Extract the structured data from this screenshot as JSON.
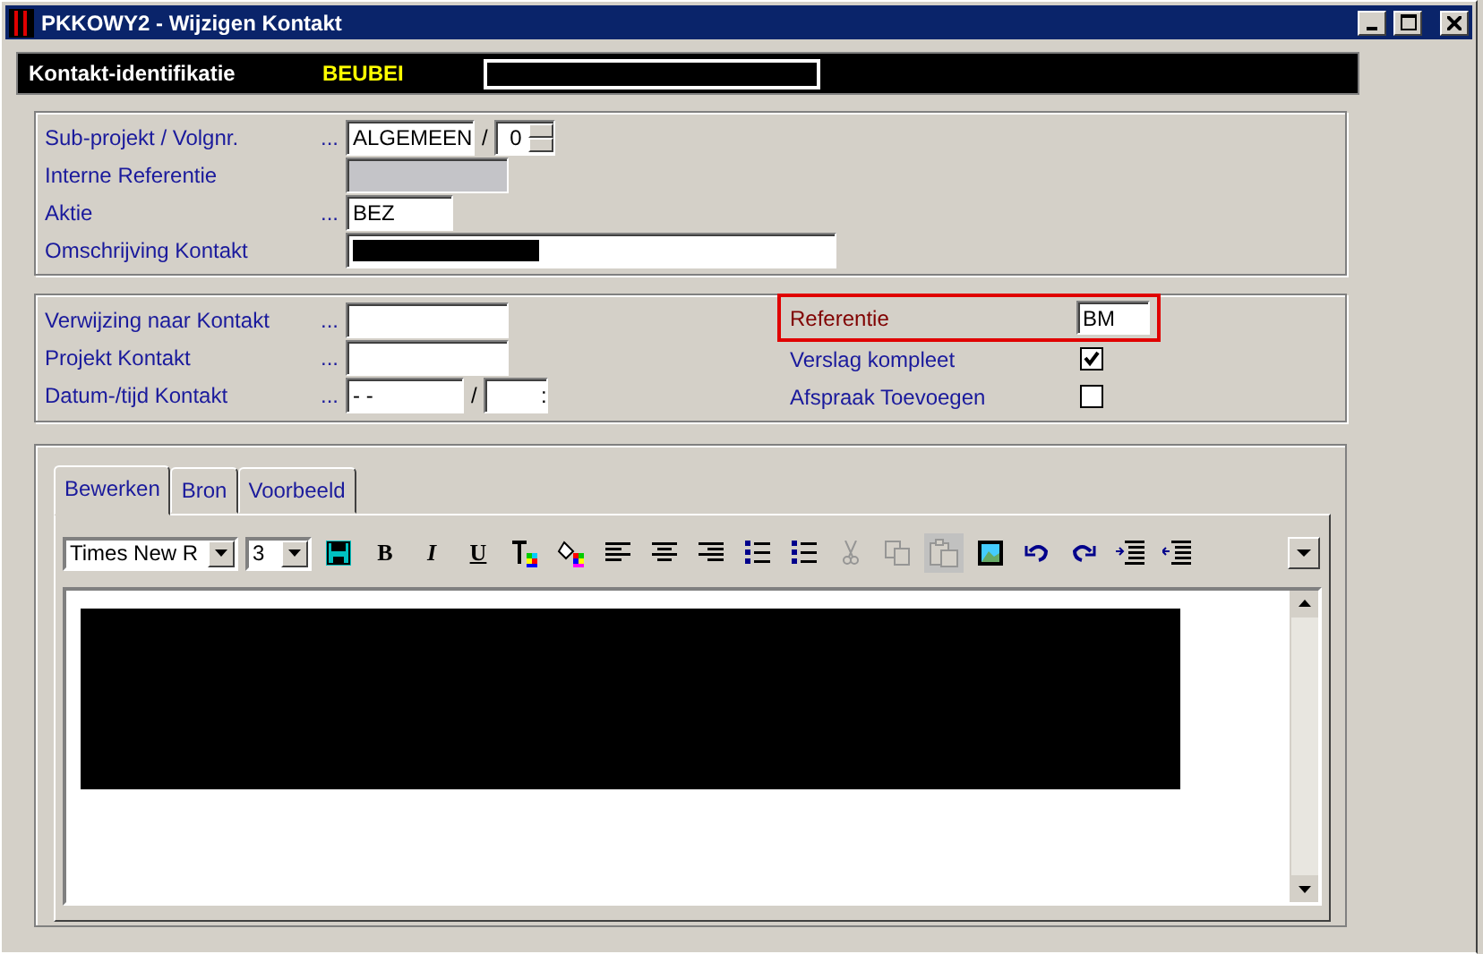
{
  "window": {
    "title": "PKKOWY2 - Wijzigen Kontakt"
  },
  "header": {
    "label": "Kontakt-identifikatie",
    "code": "BEUBEI"
  },
  "section1": [
    {
      "label": "Sub-projekt / Volgnr.",
      "dots": "...",
      "kind": "split",
      "value": "ALGEMEEN",
      "sep": "/",
      "value2": "0"
    },
    {
      "label": "Interne Referentie",
      "kind": "disabled"
    },
    {
      "label": "Aktie",
      "dots": "...",
      "kind": "text",
      "value": "BEZ"
    },
    {
      "label": "Omschrijving Kontakt",
      "kind": "redacted"
    }
  ],
  "section2_left": [
    {
      "label": "Verwijzing naar Kontakt",
      "dots": "...",
      "kind": "text"
    },
    {
      "label": "Projekt Kontakt",
      "dots": "...",
      "kind": "text"
    },
    {
      "label": "Datum-/tijd Kontakt",
      "dots": "...",
      "kind": "split",
      "value": "- -",
      "sep": "/",
      "value2": ":"
    }
  ],
  "section2_right": [
    {
      "label": "Referentie",
      "kind": "text",
      "value": "BM",
      "highlighted": true
    },
    {
      "label": "Verslag kompleet",
      "kind": "checkbox",
      "checked": true
    },
    {
      "label": "Afspraak Toevoegen",
      "kind": "checkbox",
      "checked": false
    }
  ],
  "tabs": [
    {
      "label": "Bewerken",
      "selected": true
    },
    {
      "label": "Bron",
      "selected": false
    },
    {
      "label": "Voorbeeld",
      "selected": false
    }
  ],
  "toolbar": {
    "font": "Times New R",
    "size": "3",
    "buttons": [
      {
        "kind": "save",
        "disabled": false
      },
      {
        "kind": "bold",
        "glyph": "B",
        "disabled": false
      },
      {
        "kind": "italic",
        "glyph": "I",
        "disabled": false
      },
      {
        "kind": "underline",
        "glyph": "U",
        "disabled": false
      },
      {
        "kind": "textcolor",
        "disabled": false
      },
      {
        "kind": "fill",
        "disabled": false
      },
      {
        "kind": "left",
        "disabled": false
      },
      {
        "kind": "center",
        "disabled": false
      },
      {
        "kind": "right",
        "disabled": false
      },
      {
        "kind": "ol",
        "disabled": false
      },
      {
        "kind": "ul",
        "disabled": false
      },
      {
        "kind": "cut",
        "disabled": true
      },
      {
        "kind": "copy",
        "disabled": true
      },
      {
        "kind": "paste",
        "disabled": true
      },
      {
        "kind": "image",
        "disabled": false
      },
      {
        "kind": "undo",
        "disabled": false
      },
      {
        "kind": "redo",
        "disabled": false
      },
      {
        "kind": "indent",
        "disabled": false
      },
      {
        "kind": "outdent",
        "disabled": false
      }
    ]
  }
}
